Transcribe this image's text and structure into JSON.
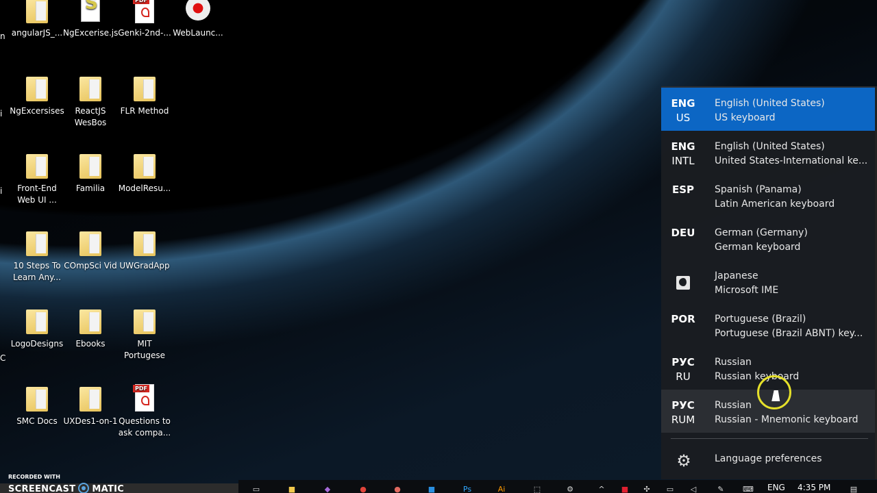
{
  "desktop": {
    "partial_labels": [
      "n",
      "i",
      "i",
      "C"
    ],
    "icons": [
      {
        "label": "angularJS_...",
        "type": "folder"
      },
      {
        "label": "NgExcerise.js",
        "type": "script"
      },
      {
        "label": "Genki-2nd-...",
        "type": "pdf"
      },
      {
        "label": "WebLaunc...",
        "type": "record"
      },
      {
        "label": "NgExcersises",
        "type": "folder"
      },
      {
        "label": "ReactJS WesBos",
        "type": "folder"
      },
      {
        "label": "FLR Method",
        "type": "folder"
      },
      {
        "label": "Front-End Web  UI ...",
        "type": "folder"
      },
      {
        "label": "Familia",
        "type": "folder"
      },
      {
        "label": "ModelResu...",
        "type": "folder"
      },
      {
        "label": "10 Steps To Learn Any...",
        "type": "folder"
      },
      {
        "label": "COmpSci Vid",
        "type": "folder"
      },
      {
        "label": "UWGradApp",
        "type": "folder"
      },
      {
        "label": "LogoDesigns",
        "type": "folder"
      },
      {
        "label": "Ebooks",
        "type": "folder"
      },
      {
        "label": "MIT Portugese",
        "type": "folder"
      },
      {
        "label": "SMC Docs",
        "type": "folder"
      },
      {
        "label": "UXDes1-on-1",
        "type": "folder"
      },
      {
        "label": "Questions to ask compa...",
        "type": "pdf"
      }
    ]
  },
  "language_flyout": {
    "items": [
      {
        "code1": "ENG",
        "code2": "US",
        "language": "English (United States)",
        "keyboard": "US keyboard",
        "state": "selected"
      },
      {
        "code1": "ENG",
        "code2": "INTL",
        "language": "English (United States)",
        "keyboard": "United States-International ke...",
        "state": "normal"
      },
      {
        "code1": "ESP",
        "code2": "",
        "language": "Spanish (Panama)",
        "keyboard": "Latin American keyboard",
        "state": "normal"
      },
      {
        "code1": "DEU",
        "code2": "",
        "language": "German (Germany)",
        "keyboard": "German keyboard",
        "state": "normal"
      },
      {
        "code1": "",
        "code2": "",
        "icon": "japanese-ime-icon",
        "language": "Japanese",
        "keyboard": "Microsoft IME",
        "state": "normal"
      },
      {
        "code1": "POR",
        "code2": "",
        "language": "Portuguese (Brazil)",
        "keyboard": "Portuguese (Brazil ABNT) key...",
        "state": "normal"
      },
      {
        "code1": "РУС",
        "code2": "RU",
        "language": "Russian",
        "keyboard": "Russian keyboard",
        "state": "normal"
      },
      {
        "code1": "РУС",
        "code2": "RUM",
        "language": "Russian",
        "keyboard": "Russian - Mnemonic keyboard",
        "state": "hover"
      }
    ],
    "preferences_label": "Language preferences",
    "selected_color": "#0c66c4"
  },
  "watermark": {
    "line1": "RECORDED WITH",
    "line2a": "SCREENCAST",
    "line2b": "MATIC"
  },
  "taskbar": {
    "apps": [
      "task-view-icon",
      "file-explorer-icon",
      "visual-studio-icon",
      "chrome-icon",
      "app-icon",
      "store-icon",
      "photoshop-icon",
      "illustrator-icon",
      "snipping-icon",
      "settings-icon"
    ],
    "app_glyphs": {
      "ps": "Ps",
      "ai": "Ai"
    },
    "tray": {
      "language": "ENG",
      "time": "4:35 PM"
    }
  }
}
